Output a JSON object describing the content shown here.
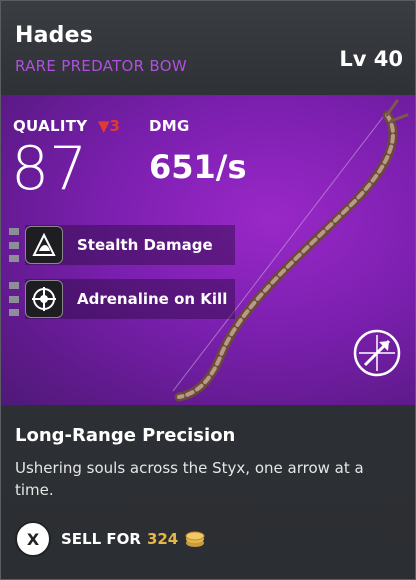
{
  "item": {
    "name": "Hades",
    "rarity": "RARE PREDATOR BOW",
    "level": "Lv 40"
  },
  "stats": {
    "quality_label": "QUALITY",
    "quality_change": "▼3",
    "quality_value": "87",
    "damage_label": "DMG",
    "damage_value": "651/s"
  },
  "perks": [
    {
      "label": "Stealth Damage",
      "icon": "stealth-assassin-icon"
    },
    {
      "label": "Adrenaline on Kill",
      "icon": "adrenaline-crosshair-icon"
    }
  ],
  "ability": {
    "title": "Long-Range Precision",
    "description": "Ushering souls across the Styx, one arrow at a time."
  },
  "sell": {
    "button": "X",
    "label": "SELL FOR",
    "price": "324",
    "icon": "coin-stack-icon"
  },
  "colors": {
    "rarity": "#b04fe0",
    "panel": "#7a1fae",
    "quality_down": "#e23a2e",
    "price": "#e5b64a"
  },
  "weapon_class_icon": "predator-bow-class-icon"
}
